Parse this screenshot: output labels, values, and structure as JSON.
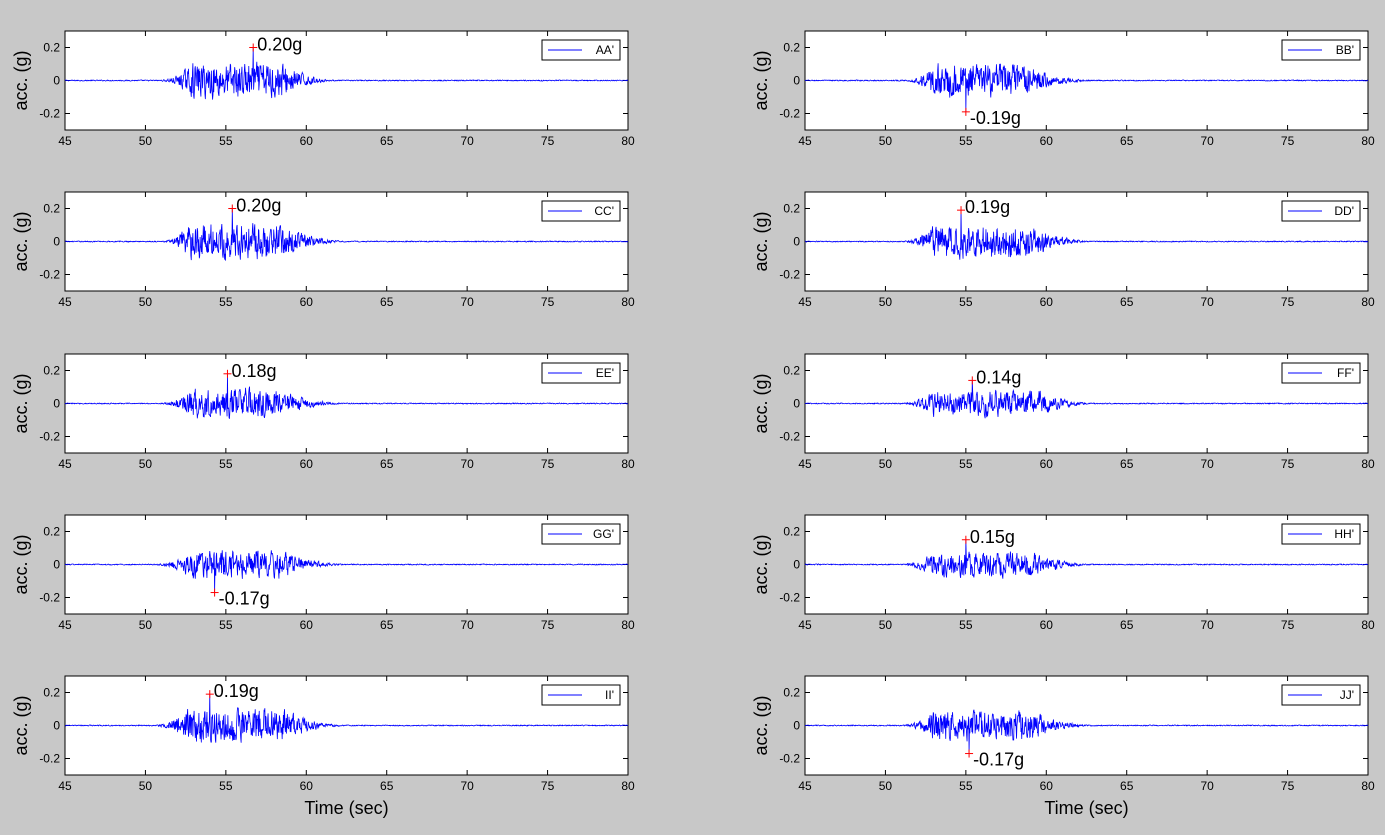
{
  "chart_data": {
    "type": "line",
    "layout": "5 rows x 2 columns of subplots",
    "line_color": "#0000ff",
    "marker_color": "#ff0000",
    "background_color": "#c8c8c8",
    "xlim": [
      45,
      80
    ],
    "ylim": [
      -0.3,
      0.3
    ],
    "x_ticks": [
      "45",
      "50",
      "55",
      "60",
      "65",
      "70",
      "75",
      "80"
    ],
    "y_ticks": [
      "0.2",
      "0",
      "-0.2"
    ],
    "ylabel": "acc. (g)",
    "xlabel": "Time (sec)",
    "grid": false,
    "legend_position": "top-right",
    "panels": [
      {
        "name": "AA'",
        "legend": "AA'",
        "peak": {
          "t": 56.7,
          "value": 0.2,
          "label": "0.20g"
        },
        "envelope": {
          "start": 50.8,
          "peak_start": 53.0,
          "peak_end": 58.5,
          "end": 61.8,
          "amp": 0.13
        }
      },
      {
        "name": "BB'",
        "legend": "BB'",
        "peak": {
          "t": 55.0,
          "value": -0.19,
          "label": "-0.19g"
        },
        "envelope": {
          "start": 51.2,
          "peak_start": 53.0,
          "peak_end": 58.5,
          "end": 63.0,
          "amp": 0.12
        }
      },
      {
        "name": "CC'",
        "legend": "CC'",
        "peak": {
          "t": 55.4,
          "value": 0.2,
          "label": "0.20g"
        },
        "envelope": {
          "start": 51.0,
          "peak_start": 52.8,
          "peak_end": 58.5,
          "end": 62.5,
          "amp": 0.13
        }
      },
      {
        "name": "DD'",
        "legend": "DD'",
        "peak": {
          "t": 54.7,
          "value": 0.19,
          "label": "0.19g"
        },
        "envelope": {
          "start": 51.0,
          "peak_start": 53.0,
          "peak_end": 59.0,
          "end": 63.0,
          "amp": 0.12
        }
      },
      {
        "name": "EE'",
        "legend": "EE'",
        "peak": {
          "t": 55.1,
          "value": 0.18,
          "label": "0.18g"
        },
        "envelope": {
          "start": 50.8,
          "peak_start": 53.0,
          "peak_end": 58.0,
          "end": 62.5,
          "amp": 0.11
        }
      },
      {
        "name": "FF'",
        "legend": "FF'",
        "peak": {
          "t": 55.4,
          "value": 0.14,
          "label": "0.14g"
        },
        "envelope": {
          "start": 51.0,
          "peak_start": 53.0,
          "peak_end": 59.5,
          "end": 63.0,
          "amp": 0.09
        }
      },
      {
        "name": "GG'",
        "legend": "GG'",
        "peak": {
          "t": 54.3,
          "value": -0.17,
          "label": "-0.17g"
        },
        "envelope": {
          "start": 50.5,
          "peak_start": 53.0,
          "peak_end": 58.5,
          "end": 62.5,
          "amp": 0.1
        }
      },
      {
        "name": "HH'",
        "legend": "HH'",
        "peak": {
          "t": 55.0,
          "value": 0.15,
          "label": "0.15g"
        },
        "envelope": {
          "start": 51.0,
          "peak_start": 53.0,
          "peak_end": 59.0,
          "end": 63.0,
          "amp": 0.09
        }
      },
      {
        "name": "II'",
        "legend": "II'",
        "peak": {
          "t": 54.0,
          "value": 0.19,
          "label": "0.19g"
        },
        "envelope": {
          "start": 50.5,
          "peak_start": 52.5,
          "peak_end": 58.5,
          "end": 62.5,
          "amp": 0.12
        }
      },
      {
        "name": "JJ'",
        "legend": "JJ'",
        "peak": {
          "t": 55.2,
          "value": -0.17,
          "label": "-0.17g"
        },
        "envelope": {
          "start": 51.0,
          "peak_start": 53.0,
          "peak_end": 59.0,
          "end": 63.0,
          "amp": 0.11
        }
      }
    ]
  }
}
